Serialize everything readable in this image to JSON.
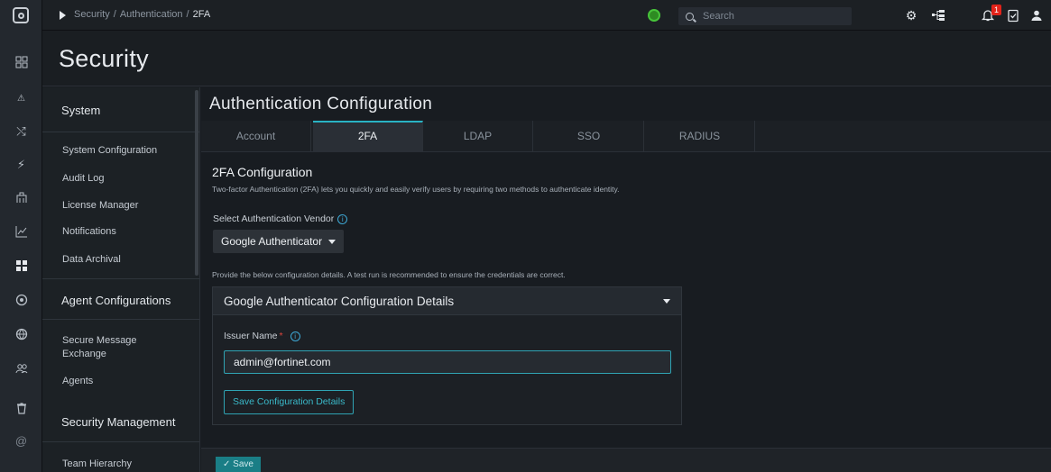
{
  "topbar": {
    "breadcrumb": [
      "Security",
      "Authentication",
      "2FA"
    ],
    "search_placeholder": "Search",
    "notification_count": "1"
  },
  "page": {
    "title": "Security"
  },
  "leftnav": {
    "sections": [
      {
        "title": "System",
        "items": [
          "System Configuration",
          "Audit Log",
          "License Manager",
          "Notifications",
          "Data Archival"
        ]
      },
      {
        "title": "Agent Configurations",
        "items": [
          "Secure Message Exchange",
          "Agents"
        ]
      },
      {
        "title": "Security Management",
        "items": [
          "Team Hierarchy"
        ]
      }
    ]
  },
  "main": {
    "title": "Authentication Configuration",
    "tabs": [
      "Account",
      "2FA",
      "LDAP",
      "SSO",
      "RADIUS"
    ],
    "active_tab": "2FA",
    "section_title": "2FA Configuration",
    "section_desc": "Two-factor Authentication (2FA) lets you quickly and easily verify users by requiring two methods to authenticate identity.",
    "vendor_label": "Select Authentication Vendor",
    "vendor_value": "Google Authenticator",
    "config_note": "Provide the below configuration details. A test run is recommended to ensure the credentials are correct.",
    "panel": {
      "title": "Google Authenticator Configuration Details",
      "issuer_label": "Issuer Name",
      "required_mark": "*",
      "issuer_value": "admin@fortinet.com",
      "save_config_label": "Save Configuration Details"
    }
  },
  "footer": {
    "save_label": "✓ Save"
  },
  "colors": {
    "accent": "#29b3c4",
    "background": "#181c21",
    "badge": "#e2231a",
    "status": "#47c43a"
  },
  "icons": [
    "logo-icon",
    "breadcrumb-toggle-icon",
    "status-icon",
    "search-icon",
    "settings-icon",
    "hierarchy-icon",
    "bell-icon",
    "clipboard-icon",
    "user-icon",
    "dashboard-icon",
    "incidents-icon",
    "shuffle-icon",
    "automation-icon",
    "building-icon",
    "chart-icon",
    "apps-icon",
    "target-icon",
    "globe-icon",
    "users-icon",
    "trash-icon",
    "at-icon"
  ]
}
